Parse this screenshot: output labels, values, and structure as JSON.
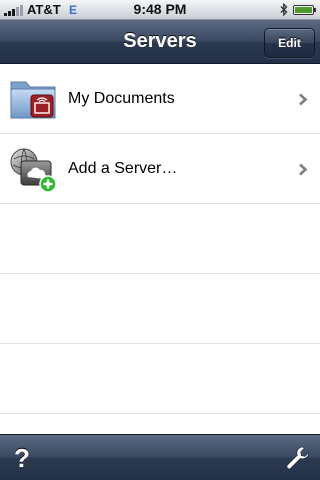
{
  "status_bar": {
    "carrier": "AT&T",
    "network": "E",
    "time": "9:48 PM",
    "icons": [
      "signal-bars-icon",
      "bluetooth-icon",
      "battery-icon"
    ]
  },
  "nav_bar": {
    "title": "Servers",
    "edit_label": "Edit"
  },
  "table": {
    "rows": [
      {
        "label": "My Documents",
        "icon": "documents-folder-icon",
        "accessory": "chevron-right-icon"
      },
      {
        "label": "Add a Server…",
        "icon": "add-server-icon",
        "accessory": "chevron-right-icon"
      }
    ]
  },
  "toolbar": {
    "help_label": "?",
    "settings_icon": "wrench-icon"
  },
  "colors": {
    "nav_bar": "#3b4a62",
    "network_indicator": "#3870d0",
    "add_badge": "#2eb82e"
  }
}
